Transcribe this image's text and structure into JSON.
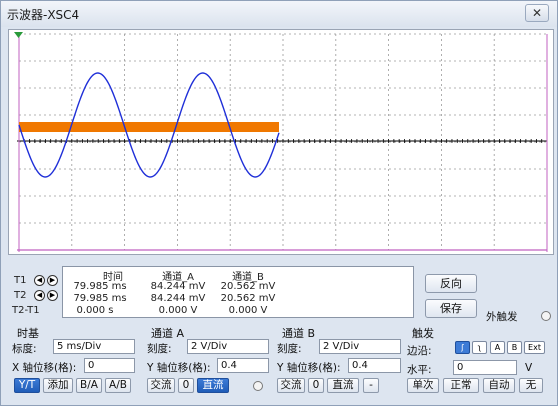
{
  "window": {
    "title": "示波器-XSC4",
    "close_glyph": "✕"
  },
  "screen": {
    "background": "#ffffff",
    "trace_color": "#1f2fd8",
    "marker_color": "#f07800",
    "cursor_color": "#c060c0"
  },
  "readout": {
    "headers": {
      "time": "时间",
      "ch_a": "通道_A",
      "ch_b": "通道_B"
    },
    "rows": [
      {
        "label": "T1",
        "time": "79.985 ms",
        "a": "84.244 mV",
        "b": "20.562 mV"
      },
      {
        "label": "T2",
        "time": "79.985 ms",
        "a": "84.244 mV",
        "b": "20.562 mV"
      },
      {
        "label": "T2-T1",
        "time": "0.000 s",
        "a": "0.000 V",
        "b": "0.000 V"
      }
    ]
  },
  "right_buttons": {
    "reverse": "反向",
    "save": "保存",
    "ext_trigger": "外触发"
  },
  "timebase": {
    "title": "时基",
    "scale_label": "标度:",
    "scale_value": "5 ms/Div",
    "xpos_label": "X 轴位移(格):",
    "xpos_value": "0",
    "modes": [
      "Y/T",
      "添加",
      "B/A",
      "A/B"
    ]
  },
  "channel_a": {
    "title": "通道 A",
    "scale_label": "刻度:",
    "scale_value": "2 V/Div",
    "ypos_label": "Y 轴位移(格):",
    "ypos_value": "0.4",
    "coupling": [
      "交流",
      "0",
      "直流"
    ]
  },
  "channel_b": {
    "title": "通道 B",
    "scale_label": "刻度:",
    "scale_value": "2 V/Div",
    "ypos_label": "Y 轴位移(格):",
    "ypos_value": "0.4",
    "coupling": [
      "交流",
      "0",
      "直流"
    ]
  },
  "trigger": {
    "title": "触发",
    "edge_label": "边沿:",
    "edge_buttons": [
      "F",
      "Ł",
      "A",
      "B",
      "Ext"
    ],
    "level_label": "水平:",
    "level_value": "0",
    "level_unit": "V",
    "modes": [
      "单次",
      "正常",
      "自动",
      "无"
    ]
  }
}
